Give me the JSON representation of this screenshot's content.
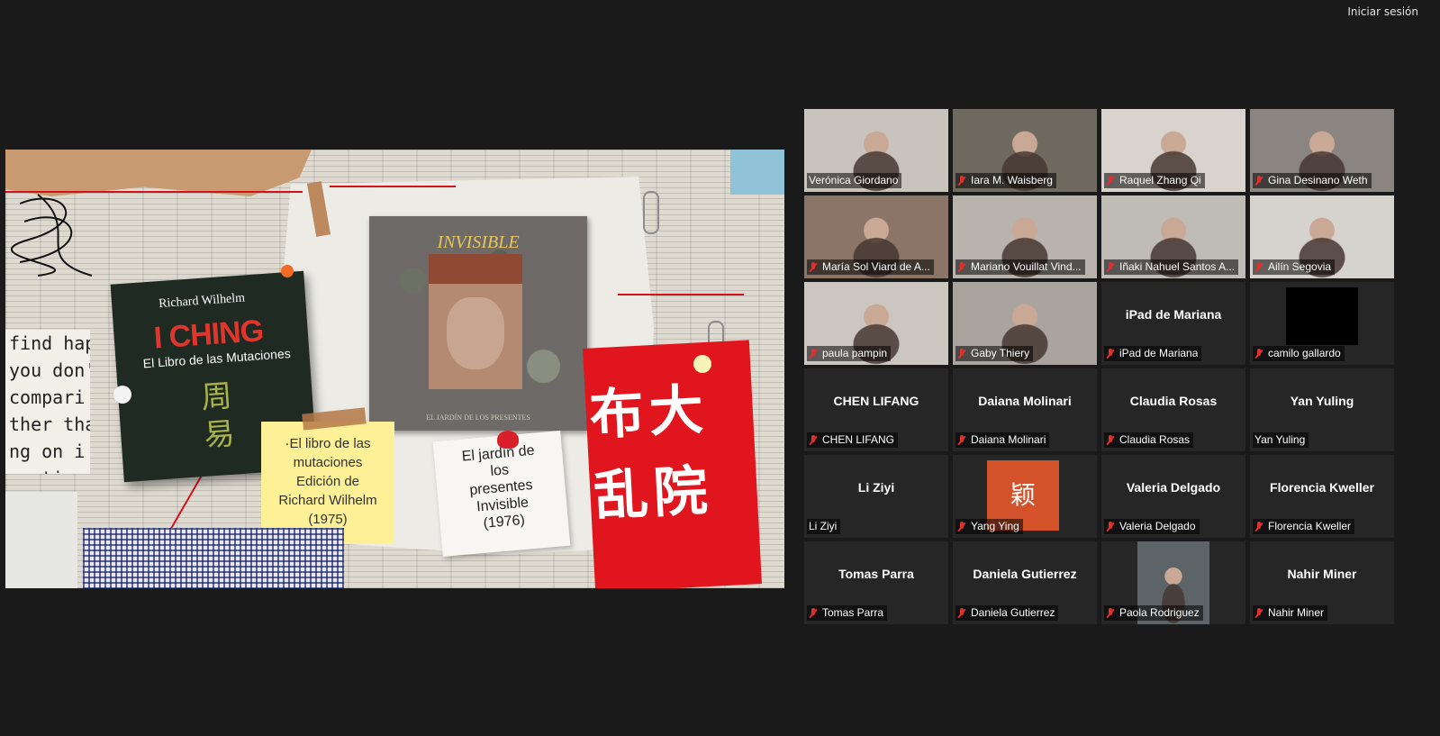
{
  "header": {
    "signin_label": "Iniciar sesión"
  },
  "slide": {
    "book_author": "Richard Wilhelm",
    "book_title": "I CHING",
    "book_subtitle": "El Libro de las Mutaciones",
    "book_glyphs": "周易",
    "find_text": "find hap\nyou don'\ncompari\nther tha\nng on i\negative",
    "photo_title": "INVISIBLE",
    "photo_caption": "EL JARDÍN DE LOS PRESENTES",
    "note1_lines": [
      "·El libro de las",
      "mutaciones",
      "Edición de",
      "Richard Wilhelm",
      "(1975)"
    ],
    "note2_lines": [
      "El jardín de",
      "los",
      "presentes",
      "Invisible",
      "(1976)"
    ],
    "poster_chars": [
      "布",
      "大",
      "乱",
      "院"
    ]
  },
  "participants": [
    {
      "name": "Verónica Giordano",
      "muted": false,
      "video": true,
      "active": true,
      "color": "#c9c3bd"
    },
    {
      "name": "Iara M. Waisberg",
      "muted": true,
      "video": true,
      "color": "#6f6a5f"
    },
    {
      "name": "Raquel Zhang Qi",
      "muted": true,
      "video": true,
      "color": "#d8d3cd"
    },
    {
      "name": "Gina Desinano Weth",
      "muted": true,
      "video": true,
      "color": "#8a8580"
    },
    {
      "name": "María Sol Viard de A...",
      "muted": true,
      "video": true,
      "color": "#8a7566"
    },
    {
      "name": "Mariano Vouillat Vind...",
      "muted": true,
      "video": true,
      "color": "#b8b3ad"
    },
    {
      "name": "Iñaki Nahuel Santos A...",
      "muted": true,
      "video": true,
      "color": "#bfbbb6"
    },
    {
      "name": "Ailín Segovia",
      "muted": true,
      "video": true,
      "color": "#d6d3cf"
    },
    {
      "name": "paula pampin",
      "muted": true,
      "video": true,
      "color": "#ccc6c0"
    },
    {
      "name": "Gaby Thiery",
      "muted": true,
      "video": true,
      "color": "#a9a49e"
    },
    {
      "name": "iPad de Mariana",
      "muted": true,
      "video": false,
      "center": "iPad de Mariana"
    },
    {
      "name": "camilo gallardo",
      "muted": true,
      "video": true,
      "color": "#000000"
    },
    {
      "name": "CHEN LIFANG",
      "muted": true,
      "video": false,
      "center": "CHEN LIFANG"
    },
    {
      "name": "Daiana Molinari",
      "muted": true,
      "video": false,
      "center": "Daiana Molinari"
    },
    {
      "name": "Claudia Rosas",
      "muted": true,
      "video": false,
      "center": "Claudia Rosas"
    },
    {
      "name": "Yan Yuling",
      "muted": false,
      "video": false,
      "center": "Yan Yuling"
    },
    {
      "name": "Li Ziyi",
      "muted": false,
      "video": false,
      "center": "Li Ziyi"
    },
    {
      "name": "Yang Ying",
      "muted": true,
      "video": false,
      "avatar": "颖"
    },
    {
      "name": "Valeria Delgado",
      "muted": true,
      "video": false,
      "center": "Valeria Delgado"
    },
    {
      "name": "Florencia Kweller",
      "muted": true,
      "video": false,
      "center": "Florencia Kweller"
    },
    {
      "name": "Tomas Parra",
      "muted": true,
      "video": false,
      "center": "Tomas Parra"
    },
    {
      "name": "Daniela Gutierrez",
      "muted": true,
      "video": false,
      "center": "Daniela Gutierrez"
    },
    {
      "name": "Paola Rodriguez",
      "muted": true,
      "video": true,
      "color": "#5d6468",
      "narrow": true
    },
    {
      "name": "Nahir Miner",
      "muted": true,
      "video": false,
      "center": "Nahir Miner"
    }
  ]
}
